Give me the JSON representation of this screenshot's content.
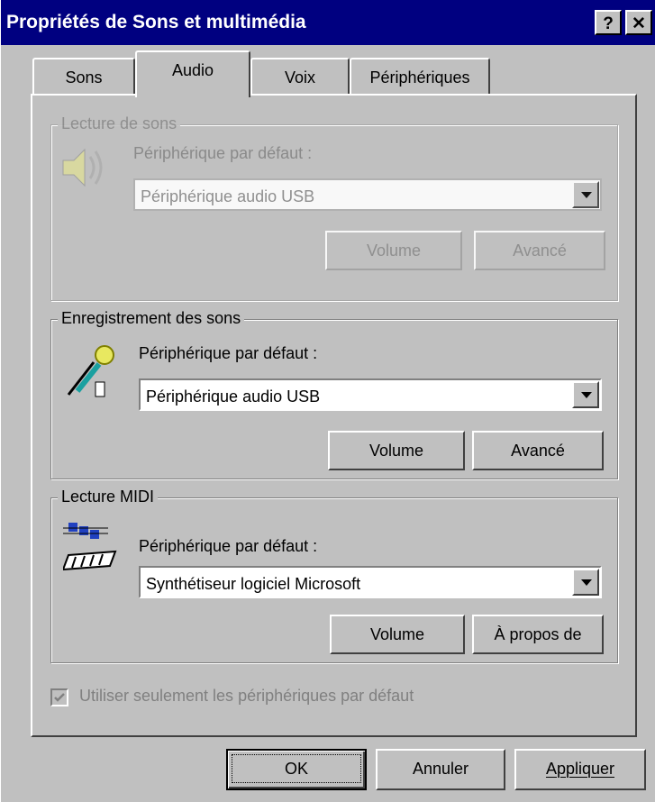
{
  "window": {
    "title": "Propriétés de Sons et multimédia",
    "help_label": "?",
    "close_label": "✕"
  },
  "tabs": [
    {
      "label": "Sons",
      "active": false
    },
    {
      "label": "Audio",
      "active": true
    },
    {
      "label": "Voix",
      "active": false
    },
    {
      "label": "Périphériques",
      "active": false
    }
  ],
  "playback": {
    "group_label": "Lecture de sons",
    "device_label": "Périphérique par défaut :",
    "device_value": "Périphérique audio USB",
    "volume_label": "Volume",
    "advanced_label": "Avancé"
  },
  "recording": {
    "group_label": "Enregistrement des sons",
    "device_label": "Périphérique par défaut :",
    "device_value": "Périphérique audio USB",
    "volume_label": "Volume",
    "advanced_label": "Avancé"
  },
  "midi": {
    "group_label": "Lecture MIDI",
    "device_label": "Périphérique par défaut :",
    "device_value": "Synthétiseur logiciel Microsoft",
    "volume_label": "Volume",
    "about_label": "À propos de"
  },
  "options": {
    "default_only_label": "Utiliser seulement les périphériques par défaut",
    "default_only_checked": true
  },
  "footer": {
    "ok_label": "OK",
    "cancel_label": "Annuler",
    "apply_label": "Appliquer"
  },
  "colors": {
    "titlebar": "#000080",
    "face": "#c0c0c0"
  }
}
